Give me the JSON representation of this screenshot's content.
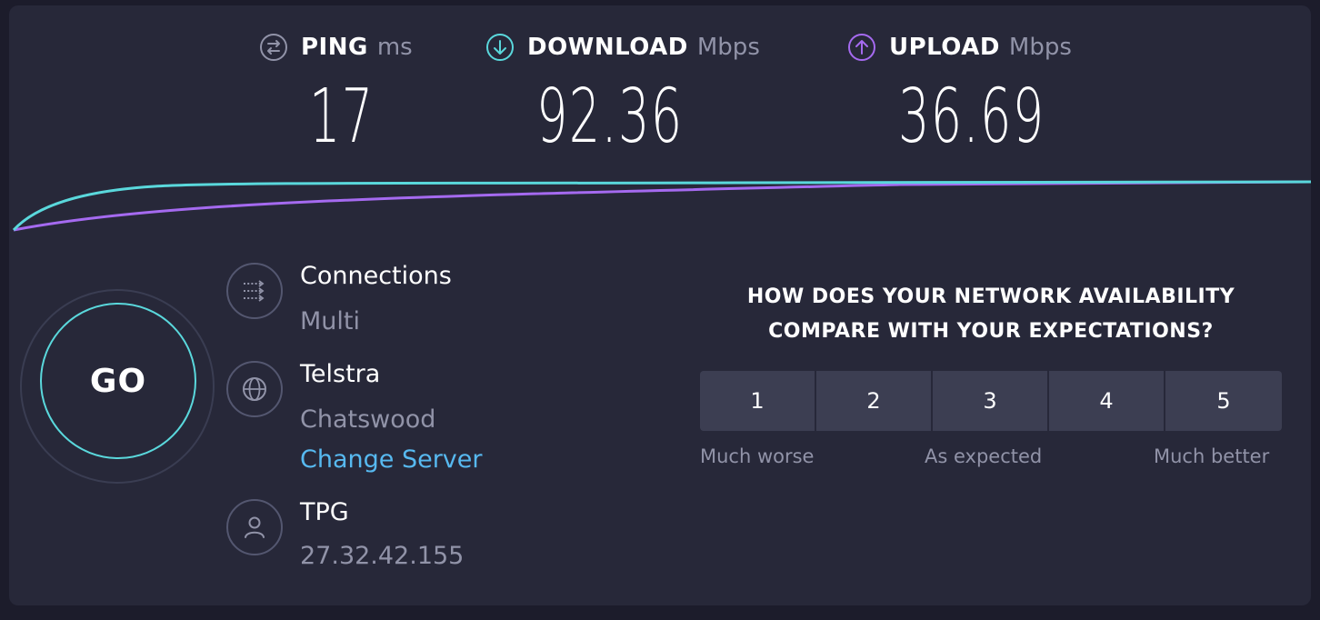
{
  "metrics": {
    "ping": {
      "name": "PING",
      "unit": "ms",
      "value": "17",
      "icon": "ping-icon"
    },
    "download": {
      "name": "DOWNLOAD",
      "unit": "Mbps",
      "value": "92.36",
      "icon": "download-arrow-icon"
    },
    "upload": {
      "name": "UPLOAD",
      "unit": "Mbps",
      "value": "36.69",
      "icon": "upload-arrow-icon"
    }
  },
  "colors": {
    "background": "#1c1c2b",
    "panel": "#272839",
    "download": "#5ad8dc",
    "upload": "#a56af0",
    "link": "#57b9f0",
    "muted": "#9193a8"
  },
  "go_button": {
    "label": "GO"
  },
  "connections": {
    "title": "Connections",
    "value": "Multi",
    "icon": "connections-icon"
  },
  "server": {
    "name": "Telstra",
    "location": "Chatswood",
    "change_label": "Change Server",
    "icon": "globe-icon"
  },
  "provider": {
    "name": "TPG",
    "ip": "27.32.42.155",
    "icon": "user-icon"
  },
  "survey": {
    "question_line1": "HOW DOES YOUR NETWORK AVAILABILITY",
    "question_line2": "COMPARE WITH YOUR EXPECTATIONS?",
    "options": [
      "1",
      "2",
      "3",
      "4",
      "5"
    ],
    "low_label": "Much worse",
    "mid_label": "As expected",
    "high_label": "Much better"
  }
}
